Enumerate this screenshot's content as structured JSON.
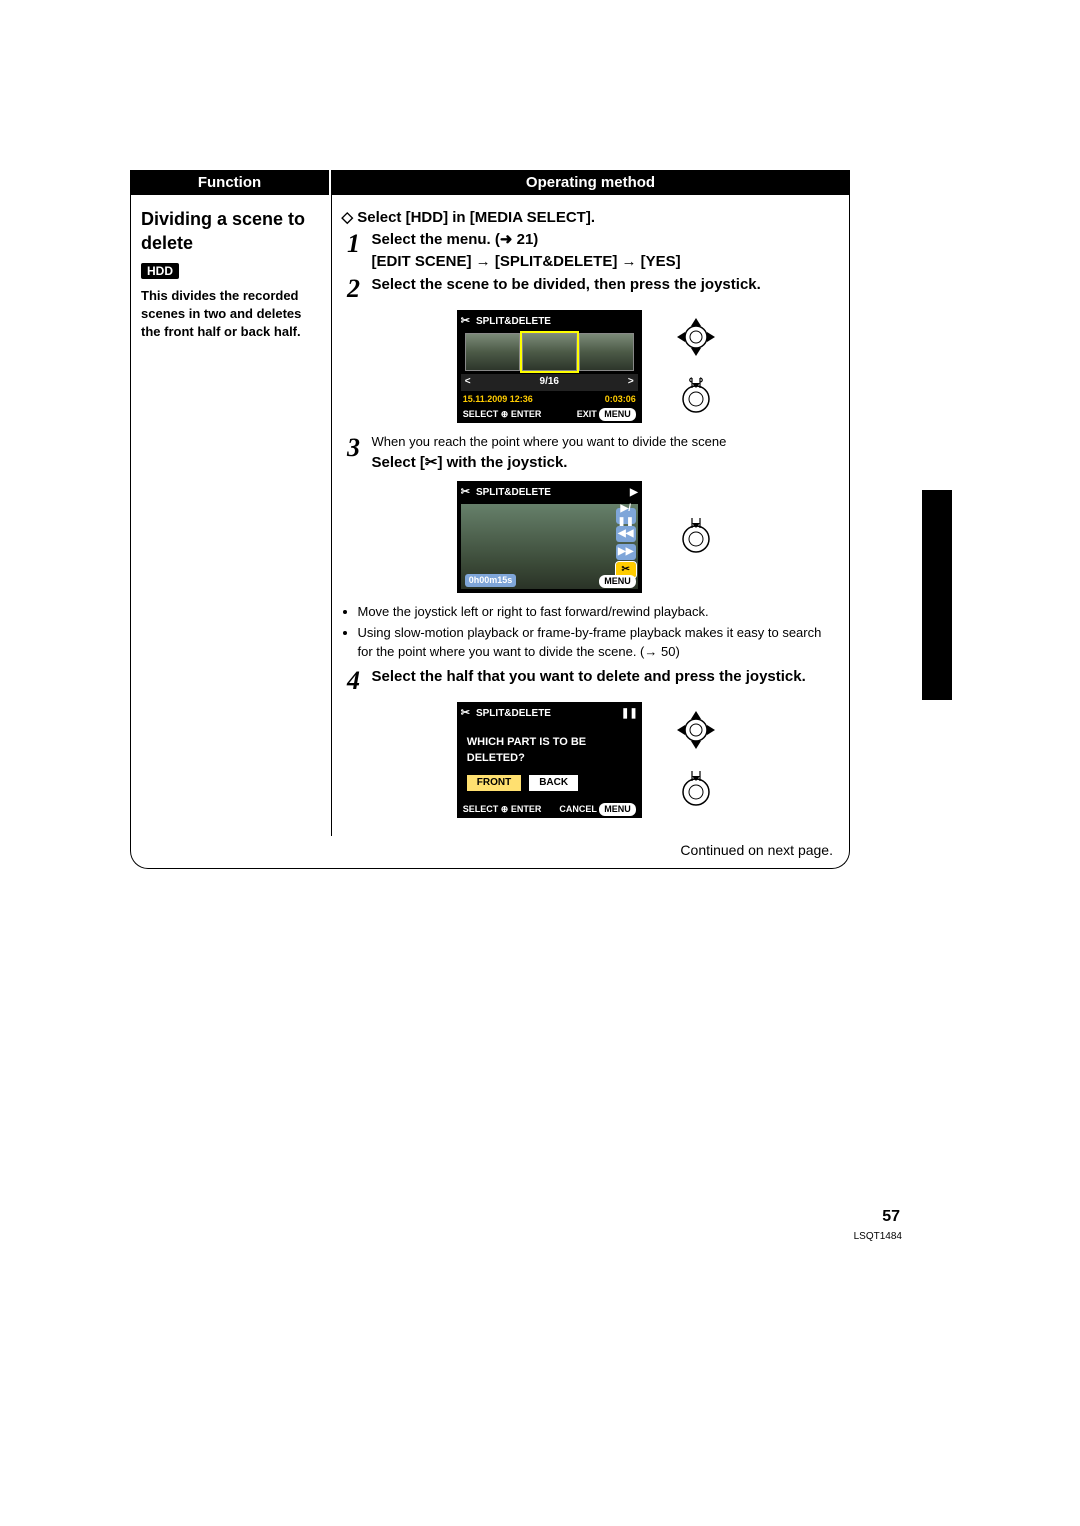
{
  "header": {
    "function": "Function",
    "operating_method": "Operating method"
  },
  "left": {
    "title": "Dividing a scene to delete",
    "badge": "HDD",
    "desc": "This divides the recorded scenes in two and deletes the front half or back half."
  },
  "op": {
    "select_hdd": "Select [HDD] in [MEDIA SELECT].",
    "step1a": "Select the menu. (",
    "step1ref": " 21)",
    "step1b": "[EDIT SCENE] → [SPLIT&DELETE] → [YES]",
    "step2": "Select the scene to be divided, then press the joystick.",
    "step3a": "When you reach the point where you want to divide the scene",
    "step3b_before": "Select [",
    "step3b_after": "] with the joystick.",
    "notes": [
      "Move the joystick left or right to fast forward/rewind playback.",
      "Using slow-motion playback or frame-by-frame playback makes it easy to search for the point where you want to divide the scene. (→ 50)"
    ],
    "step4": "Select the half that you want to delete and press the joystick.",
    "continued": "Continued on next page."
  },
  "ms1": {
    "title": "SPLIT&DELETE",
    "nav_left": "<",
    "nav_mid": "9/16",
    "nav_right": ">",
    "date": "15.11.2009 12:36",
    "dur": "0:03:06",
    "select": "SELECT",
    "enter": "ENTER",
    "exit": "EXIT",
    "menu": "MENU"
  },
  "ms2": {
    "title": "SPLIT&DELETE",
    "play": "▶",
    "tc": "0h00m15s",
    "menu": "MENU"
  },
  "ms3": {
    "title": "SPLIT&DELETE",
    "pause": "❚❚",
    "question": "WHICH PART IS TO BE DELETED?",
    "front": "FRONT",
    "back": "BACK",
    "select": "SELECT",
    "enter": "ENTER",
    "cancel": "CANCEL",
    "menu": "MENU"
  },
  "footer": {
    "page": "57",
    "doc_id": "LSQT1484"
  }
}
